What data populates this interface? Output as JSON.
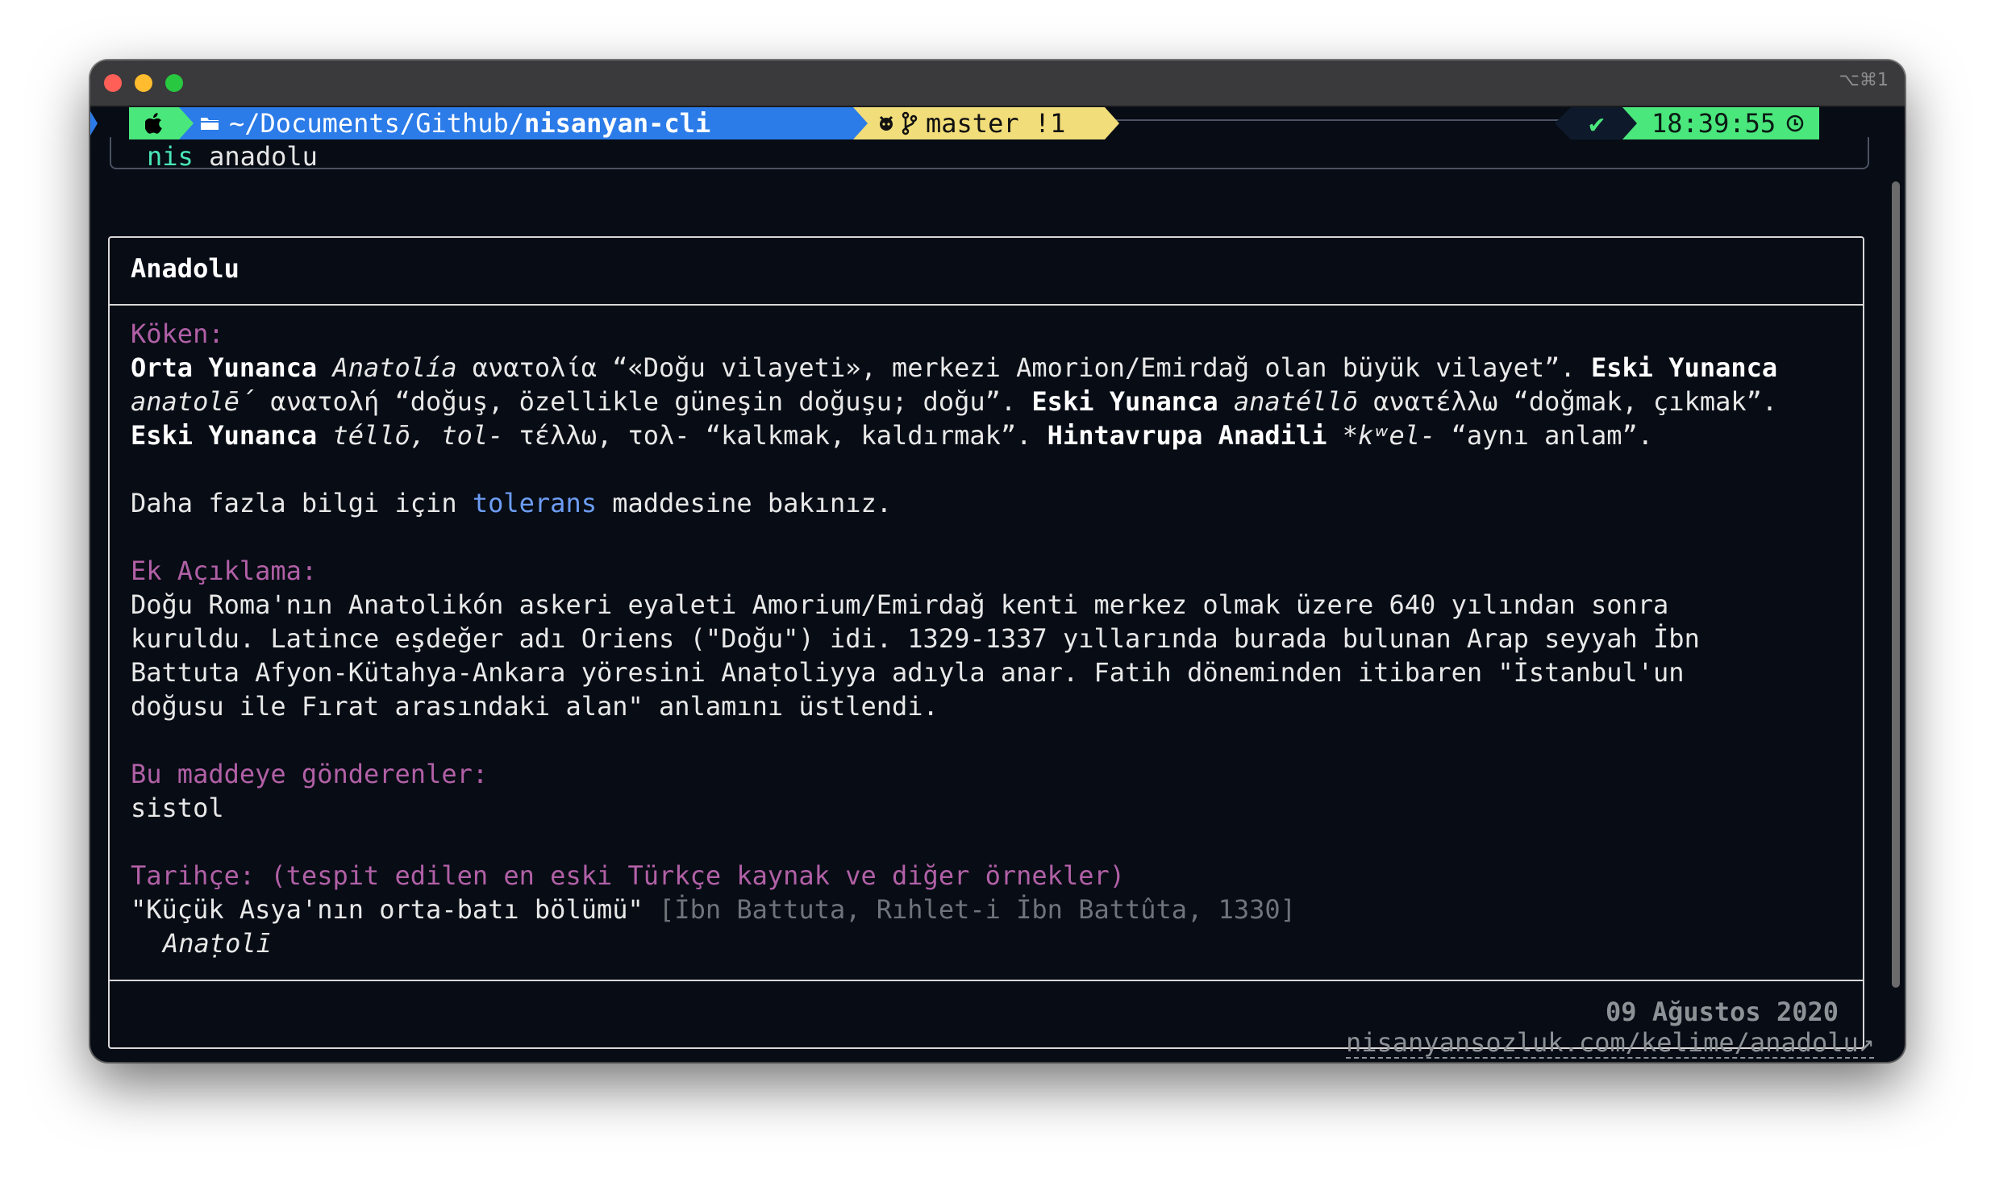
{
  "window": {
    "shortcut": "⌥⌘1"
  },
  "prompt": {
    "apple_icon": "apple-logo",
    "folder_icon": "folder-icon",
    "path_prefix": "~/Documents/Github/",
    "path_dir": "nisanyan-cli",
    "github_icon": "github-icon",
    "branch_icon": "git-branch-icon",
    "branch": "master !1",
    "status_icon": "✔",
    "time": "18:39:55",
    "clock_icon": "clock-icon"
  },
  "command": {
    "name": "nis",
    "arg": "anadolu"
  },
  "entry": {
    "title": "Anadolu",
    "koken_label": "Köken:",
    "koken_lines": [
      [
        {
          "t": "Orta Yunanca",
          "s": "b"
        },
        {
          "t": " "
        },
        {
          "t": "Anatolía",
          "s": "i"
        },
        {
          "t": " ανατολία “«Doğu vilayeti», merkezi Amorion/Emirdağ olan büyük vilayet”. "
        },
        {
          "t": "Eski Yunanca",
          "s": "b"
        }
      ],
      [
        {
          "t": "anatolḗ",
          "s": "i"
        },
        {
          "t": " ανατολή “doğuş, özellikle güneşin doğuşu; doğu”. "
        },
        {
          "t": "Eski Yunanca",
          "s": "b"
        },
        {
          "t": " "
        },
        {
          "t": "anatéllō",
          "s": "i"
        },
        {
          "t": " ανατέλλω “doğmak, çıkmak”."
        }
      ],
      [
        {
          "t": "Eski Yunanca",
          "s": "b"
        },
        {
          "t": " "
        },
        {
          "t": "téllō, tol-",
          "s": "i"
        },
        {
          "t": " τέλλω, τολ- “kalkmak, kaldırmak”. "
        },
        {
          "t": "Hintavrupa Anadili",
          "s": "b"
        },
        {
          "t": " "
        },
        {
          "t": "*kʷel-",
          "s": "i"
        },
        {
          "t": " “aynı anlam”."
        }
      ]
    ],
    "see_also": {
      "before": "Daha fazla bilgi için ",
      "link": "tolerans",
      "after": " maddesine bakınız."
    },
    "ek_label": "Ek Açıklama:",
    "ek_lines": [
      "Doğu Roma'nın Anatolikón askeri eyaleti Amorium/Emirdağ kenti merkez olmak üzere 640 yılından sonra",
      "kuruldu. Latince eşdeğer adı Oriens (\"Doğu\") idi. 1329-1337 yıllarında burada bulunan Arap seyyah İbn",
      "Battuta Afyon-Kütahya-Ankara yöresini Anaṭoliyya adıyla anar. Fatih döneminden itibaren \"İstanbul'un",
      "doğusu ile Fırat arasındaki alan\" anlamını üstlendi."
    ],
    "refs_label": "Bu maddeye gönderenler:",
    "refs": "sistol",
    "history_label": "Tarihçe: (tespit edilen en eski Türkçe kaynak ve diğer örnekler)",
    "history_quote": "\"Küçük Asya'nın orta-batı bölümü\"",
    "history_source": "[İbn Battuta, Rıhlet-i İbn Battûta, 1330]",
    "history_form": "Anaṭolī",
    "date": "09 Ağustos 2020"
  },
  "footer": {
    "url": "nisanyansozluk.com/kelime/anadolu↗"
  }
}
